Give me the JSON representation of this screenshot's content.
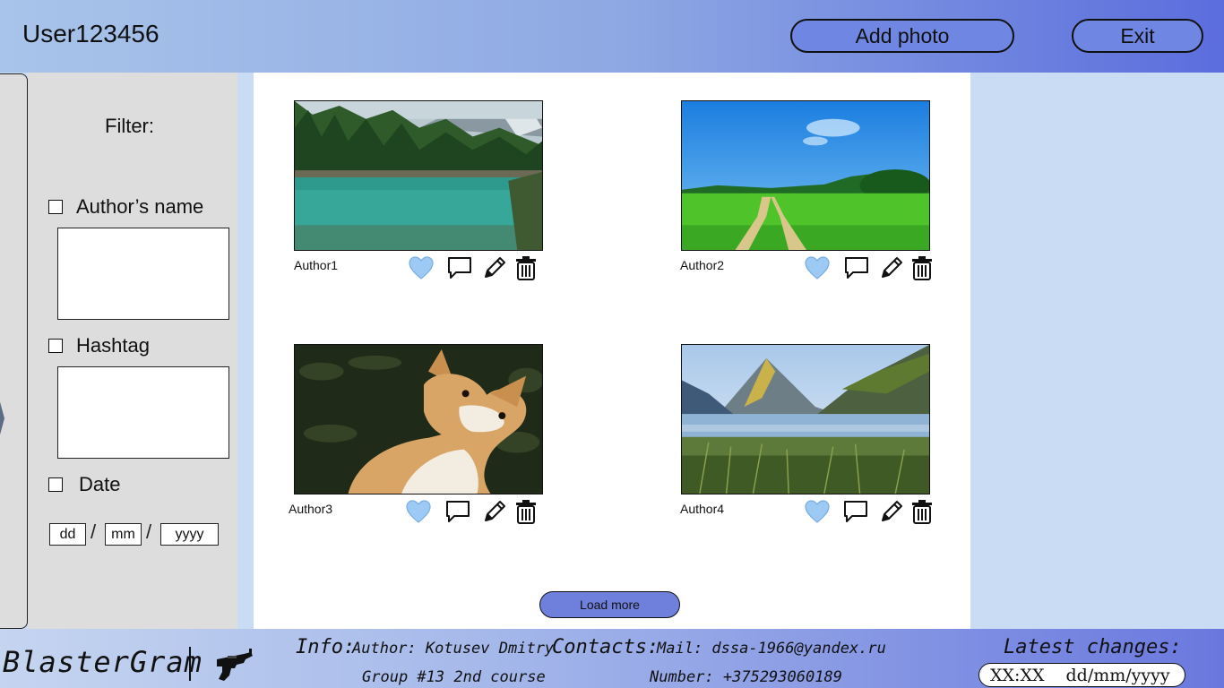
{
  "header": {
    "username": "User123456",
    "add_photo_label": "Add photo",
    "exit_label": "Exit"
  },
  "filter": {
    "title": "Filter:",
    "author_label": "Author’s name",
    "hashtag_label": "Hashtag",
    "date_label": "Date",
    "date_placeholders": {
      "day": "dd",
      "month": "mm",
      "year": "yyyy"
    },
    "slash": "/"
  },
  "feed": {
    "posts": [
      {
        "author": "Author1"
      },
      {
        "author": "Author2"
      },
      {
        "author": "Author3"
      },
      {
        "author": "Author4"
      }
    ],
    "load_more_label": "Load more"
  },
  "footer": {
    "brand": "BlasterGram",
    "info_label": "Info:",
    "author_line": "Author: Kotusev Dmitry",
    "group_line": "Group #13 2nd course",
    "contacts_label": "Contacts:",
    "mail_line": "Mail: dssa-1966@yandex.ru",
    "number_line": "Number: +375293060189",
    "latest_label": "Latest changes:",
    "latest_time": "XX:XX",
    "latest_date": "dd/mm/yyyy"
  },
  "colors": {
    "like": "#9ccaf5",
    "accent_button": "#6f86e2",
    "load_more": "#6f7fdc"
  },
  "icons": [
    "heart-icon",
    "comment-icon",
    "pencil-icon",
    "trash-icon",
    "blaster-icon"
  ]
}
